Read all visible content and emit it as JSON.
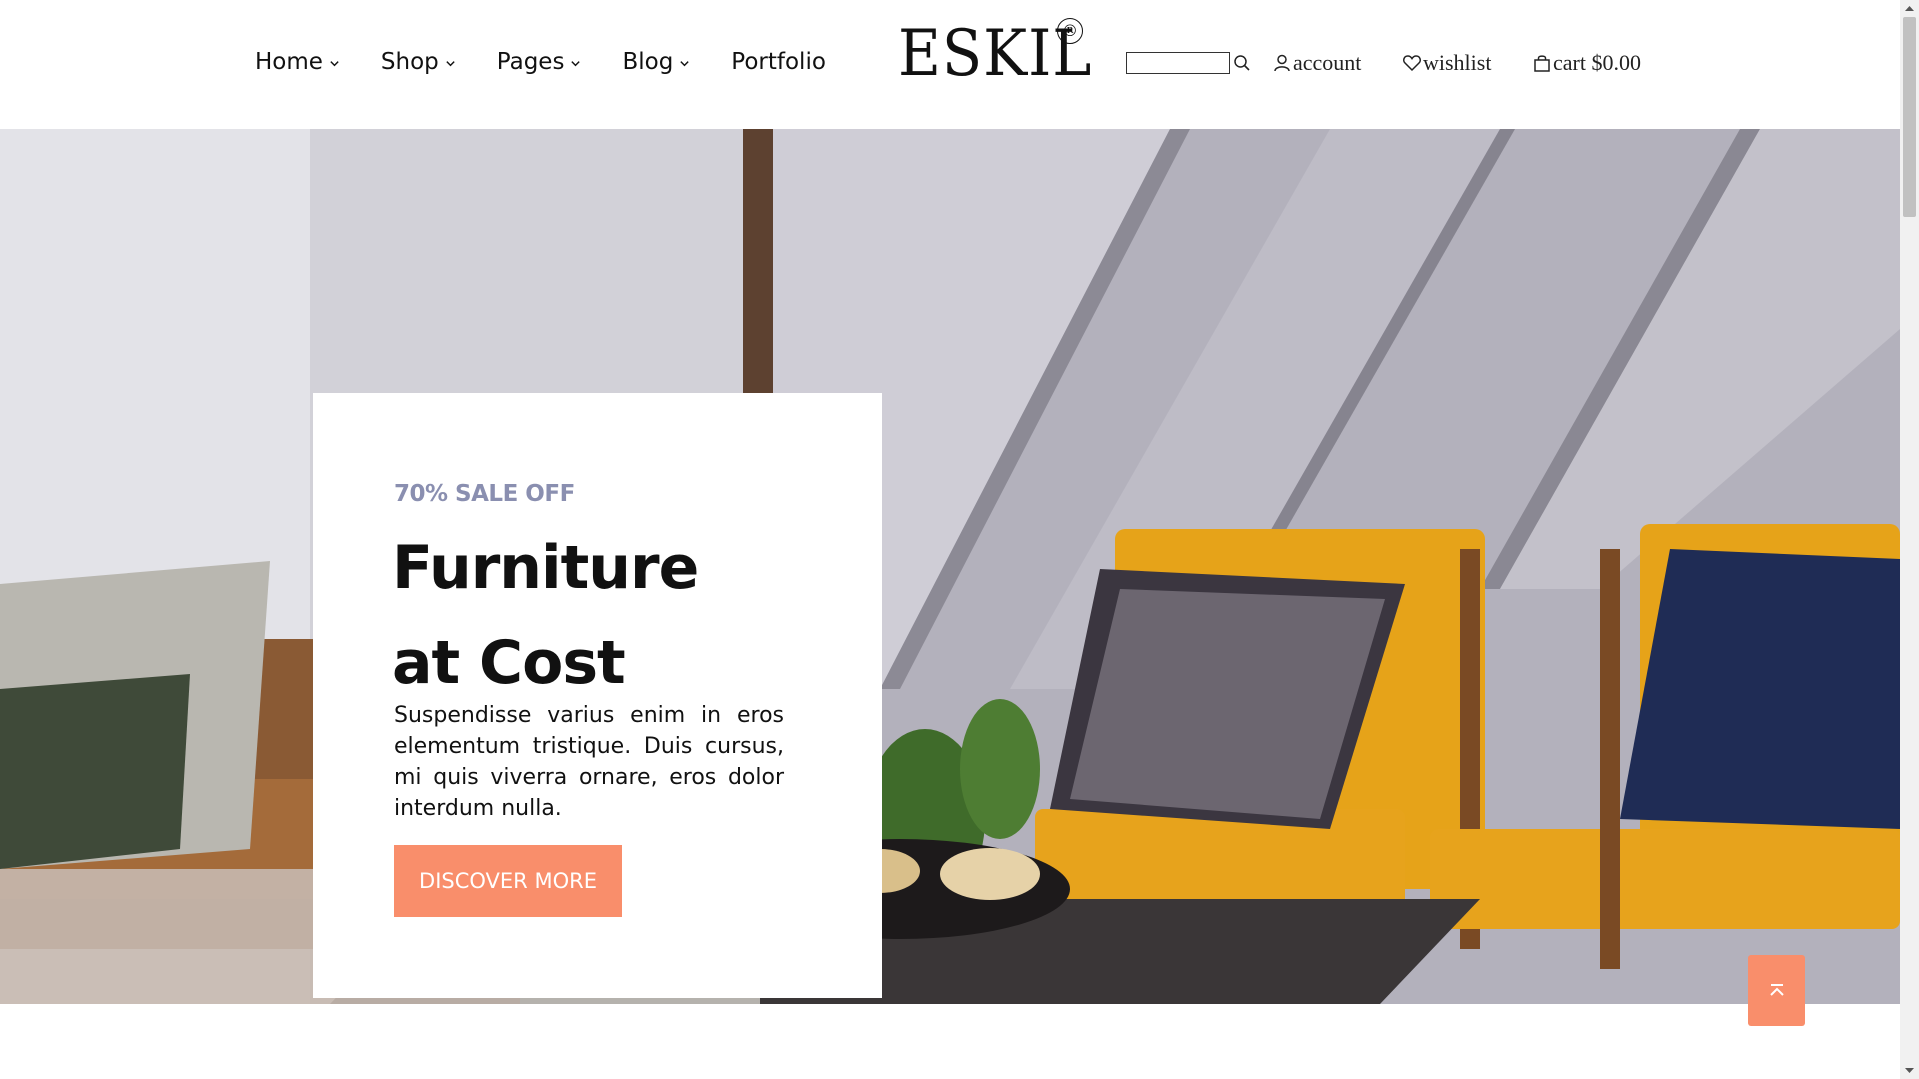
{
  "nav": {
    "items": [
      {
        "label": "Home",
        "has_dropdown": true
      },
      {
        "label": "Shop",
        "has_dropdown": true
      },
      {
        "label": "Pages",
        "has_dropdown": true
      },
      {
        "label": "Blog",
        "has_dropdown": true
      },
      {
        "label": "Portfolio",
        "has_dropdown": false
      }
    ]
  },
  "logo": {
    "text": "ESKIL",
    "mark": "®"
  },
  "search": {
    "value": "",
    "placeholder": "",
    "icon": "search-icon"
  },
  "utilities": {
    "account_label": "account",
    "wishlist_label": "wishlist",
    "cart_label": "cart $0.00"
  },
  "hero": {
    "eyebrow": "70% SALE OFF",
    "title_line1": "Furniture",
    "title_line2": "at Cost",
    "description": "Suspendisse varius enim in eros elementum tristique. Duis cursus, mi quis viverra ornare, eros dolor interdum nulla.",
    "button_label": "DISCOVER MORE"
  },
  "colors": {
    "accent": "#f98e6b",
    "eyebrow": "#8a8fb0",
    "text": "#111111"
  },
  "scroll_top": {
    "icon": "arrow-up-to-top-icon"
  }
}
